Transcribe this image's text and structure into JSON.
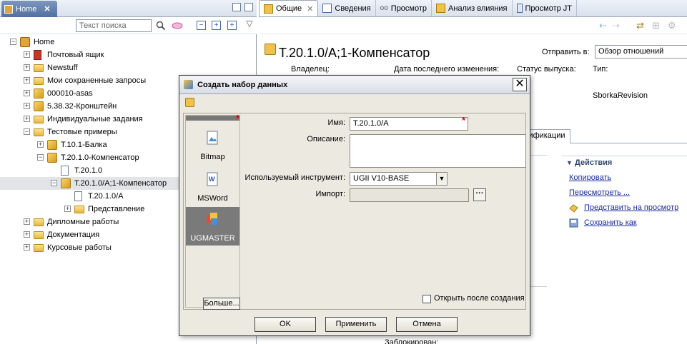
{
  "left": {
    "home_tab": "Home",
    "search_placeholder": "Текст поиска",
    "tree": [
      {
        "label": "Home",
        "level": 0,
        "icon": "home-icon",
        "expander": "−"
      },
      {
        "label": "Почтовый ящик",
        "level": 1,
        "icon": "mailbox-icon",
        "expander": "+"
      },
      {
        "label": "Newstuff",
        "level": 1,
        "icon": "folder-icon",
        "expander": "+"
      },
      {
        "label": "Мои сохраненные запросы",
        "level": 1,
        "icon": "folder-icon",
        "expander": "+"
      },
      {
        "label": "000010-asas",
        "level": 1,
        "icon": "item-icon",
        "expander": "+"
      },
      {
        "label": "5.38.32-Кронштейн",
        "level": 1,
        "icon": "item-icon",
        "expander": "+"
      },
      {
        "label": "Индивидуальные задания",
        "level": 1,
        "icon": "folder-icon",
        "expander": "+"
      },
      {
        "label": "Тестовые примеры",
        "level": 1,
        "icon": "folder-icon",
        "expander": "−"
      },
      {
        "label": "T.10.1-Балка",
        "level": 2,
        "icon": "item-icon",
        "expander": "+"
      },
      {
        "label": "T.20.1.0-Компенсатор",
        "level": 2,
        "icon": "item-icon",
        "expander": "−"
      },
      {
        "label": "T.20.1.0",
        "level": 3,
        "icon": "document-icon",
        "expander": ""
      },
      {
        "label": "T.20.1.0/A;1-Компенсатор",
        "level": 3,
        "icon": "revision-icon",
        "expander": "−"
      },
      {
        "label": "T.20.1.0/A",
        "level": 4,
        "icon": "document-icon",
        "expander": ""
      },
      {
        "label": "Представление",
        "level": 4,
        "icon": "view-folder-icon",
        "expander": "+"
      },
      {
        "label": "Дипломные работы",
        "level": 1,
        "icon": "folder-icon",
        "expander": "+"
      },
      {
        "label": "Документация",
        "level": 1,
        "icon": "folder-icon",
        "expander": "+"
      },
      {
        "label": "Курсовые работы",
        "level": 1,
        "icon": "folder-icon",
        "expander": "+"
      }
    ]
  },
  "right": {
    "tabs": [
      {
        "label": "Общие",
        "active": true,
        "closable": true
      },
      {
        "label": "Сведения",
        "active": false
      },
      {
        "label": "Просмотр",
        "active": false
      },
      {
        "label": "Анализ влияния",
        "active": false
      },
      {
        "label": "Просмотр JT",
        "active": false
      }
    ],
    "object_title": "T.20.1.0/A;1-Компенсатор",
    "send_label": "Отправить в:",
    "send_value": "Обзор отношений",
    "props": {
      "owner": "Владелец:",
      "last_modified": "Дата последнего изменения:",
      "release_status": "Статус выпуска:",
      "type": "Тип:"
    },
    "type_value": "SborkaRevision",
    "modifications_tab": "дификации",
    "actions": {
      "header": "Действия",
      "items": [
        "Копировать",
        "Пересмотреть ...",
        "Представить на просмотр",
        "Сохранить как"
      ]
    },
    "bottom_text": "Заблокирован:"
  },
  "dialog": {
    "title": "Создать набор данных",
    "tools": [
      "Bitmap",
      "MSWord",
      "UGMASTER"
    ],
    "selected_tool": "UGMASTER",
    "more_button": "Больше...",
    "name_label": "Имя:",
    "name_value": "T.20.1.0/A",
    "description_label": "Описание:",
    "description_value": "",
    "tool_label": "Используемый инструмент:",
    "tool_value": "UGII V10-BASE",
    "import_label": "Импорт:",
    "import_value": "",
    "open_after_label": "Открыть после создания",
    "open_after_checked": false,
    "buttons": {
      "ok": "OK",
      "apply": "Применить",
      "cancel": "Отмена"
    }
  }
}
